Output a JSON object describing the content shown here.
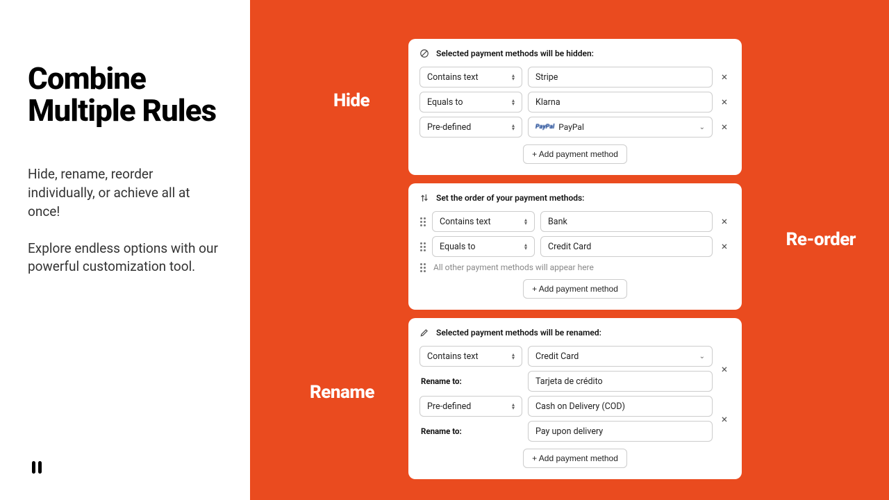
{
  "headline": "Combine Multiple Rules",
  "subtext": "Hide, rename, reorder individually, or achieve all at once!\n\nExplore endless options with our powerful customization tool.",
  "labels": {
    "hide": "Hide",
    "reorder": "Re-order",
    "rename": "Rename"
  },
  "hide_card": {
    "title": "Selected payment methods will be hidden:",
    "rows": [
      {
        "op": "Contains text",
        "val": "Stripe",
        "chevron": false
      },
      {
        "op": "Equals to",
        "val": "Klarna",
        "chevron": false
      },
      {
        "op": "Pre-defined",
        "val": "PayPal",
        "chevron": true,
        "paypal": true
      }
    ],
    "add": "+ Add payment method"
  },
  "reorder_card": {
    "title": "Set the order of your payment methods:",
    "rows": [
      {
        "op": "Contains text",
        "val": "Bank"
      },
      {
        "op": "Equals to",
        "val": "Credit Card"
      }
    ],
    "hint": "All other payment methods will appear here",
    "add": "+ Add payment method"
  },
  "rename_card": {
    "title": "Selected payment methods will be renamed:",
    "rename_label": "Rename to:",
    "groups": [
      {
        "op": "Contains text",
        "val": "Credit Card",
        "chevron": true,
        "rename": "Tarjeta de crédito"
      },
      {
        "op": "Pre-defined",
        "val": "Cash on Delivery (COD)",
        "chevron": false,
        "rename": "Pay upon delivery"
      }
    ],
    "add": "+ Add payment method"
  }
}
